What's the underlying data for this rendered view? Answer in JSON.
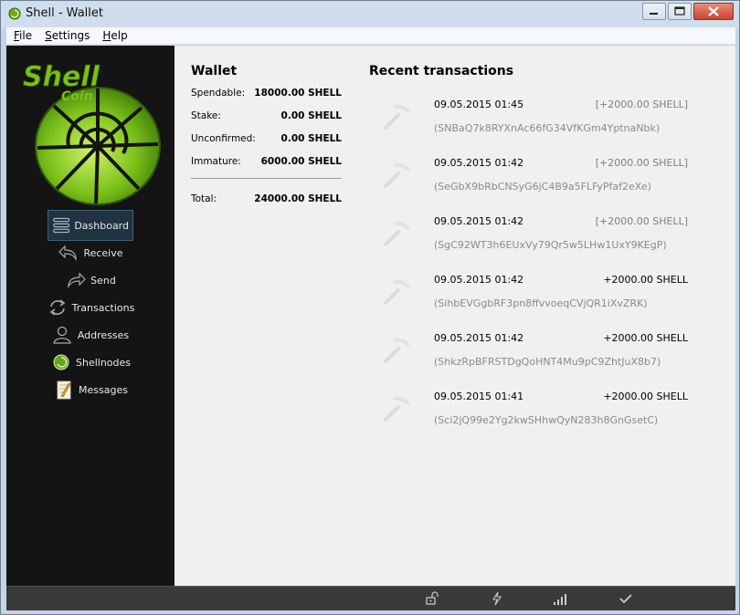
{
  "window": {
    "title": "Shell - Wallet"
  },
  "menu": {
    "file": "File",
    "settings": "Settings",
    "help": "Help"
  },
  "logo": {
    "text_line1": "Shell",
    "text_line2": "Coin"
  },
  "sidebar": {
    "items": [
      {
        "label": "Dashboard",
        "icon": "dashboard-icon",
        "active": true
      },
      {
        "label": "Receive",
        "icon": "receive-arrow-icon"
      },
      {
        "label": "Send",
        "icon": "send-arrow-icon"
      },
      {
        "label": "Transactions",
        "icon": "transactions-refresh-icon"
      },
      {
        "label": "Addresses",
        "icon": "addresses-user-icon"
      },
      {
        "label": "Shellnodes",
        "icon": "shellnodes-globe-icon"
      },
      {
        "label": "Messages",
        "icon": "messages-notepad-icon"
      }
    ]
  },
  "wallet": {
    "title": "Wallet",
    "spendable_label": "Spendable:",
    "spendable_value": "18000.00 SHELL",
    "stake_label": "Stake:",
    "stake_value": "0.00 SHELL",
    "unconfirmed_label": "Unconfirmed:",
    "unconfirmed_value": "0.00 SHELL",
    "immature_label": "Immature:",
    "immature_value": "6000.00 SHELL",
    "total_label": "Total:",
    "total_value": "24000.00 SHELL"
  },
  "recent": {
    "title": "Recent transactions",
    "transactions": [
      {
        "date": "09.05.2015 01:45",
        "amount": "[+2000.00 SHELL]",
        "address": "(SNBaQ7k8RYXnAc66fG34VfKGm4YptnaNbk)",
        "confirmed": false
      },
      {
        "date": "09.05.2015 01:42",
        "amount": "[+2000.00 SHELL]",
        "address": "(SeGbX9bRbCNSyG6jC4B9a5FLFyPfaf2eXe)",
        "confirmed": false
      },
      {
        "date": "09.05.2015 01:42",
        "amount": "[+2000.00 SHELL]",
        "address": "(SgC92WT3h6EUxVy79Qr5w5LHw1UxY9KEgP)",
        "confirmed": false
      },
      {
        "date": "09.05.2015 01:42",
        "amount": "+2000.00 SHELL",
        "address": "(SihbEVGgbRF3pn8ffvvoeqCVjQR1iXvZRK)",
        "confirmed": true
      },
      {
        "date": "09.05.2015 01:42",
        "amount": "+2000.00 SHELL",
        "address": "(ShkzRpBFRSTDgQoHNT4Mu9pC9ZhtJuX8b7)",
        "confirmed": true
      },
      {
        "date": "09.05.2015 01:41",
        "amount": "+2000.00 SHELL",
        "address": "(Sci2jQ99e2Yg2kwSHhwQyN283h8GnGsetC)",
        "confirmed": true
      }
    ]
  },
  "statusbar": {
    "icons": [
      "lock-open-icon",
      "staking-lightning-icon",
      "connections-signal-icon",
      "synced-check-icon"
    ]
  },
  "colors": {
    "sidebar_bg": "#141414",
    "main_bg": "#f0f0f0",
    "active_nav_bg": "#213340",
    "logo_green": "#7bc11a",
    "unconfirmed_text": "#7f7f7f",
    "status_bg": "#3a3a3a"
  }
}
